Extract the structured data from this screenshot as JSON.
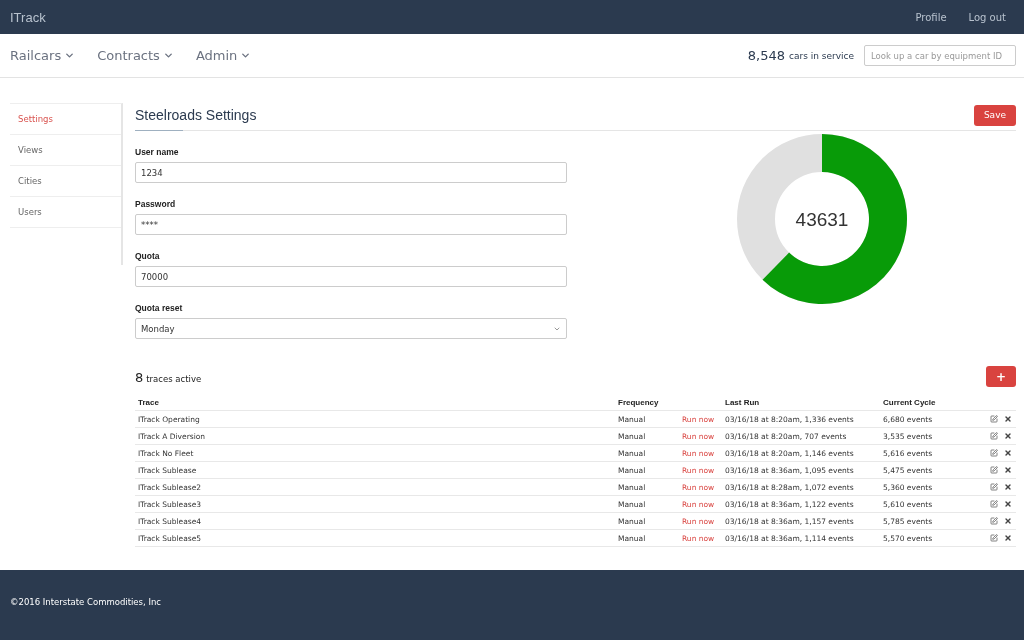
{
  "topbar": {
    "brand": "ITrack",
    "links": [
      "Profile",
      "Log out"
    ]
  },
  "nav": {
    "menus": [
      "Railcars",
      "Contracts",
      "Admin"
    ],
    "count": "8,548",
    "count_label": "cars in service",
    "search": {
      "placeholder": "Look up a car by equipment ID"
    }
  },
  "sidebar": {
    "items": [
      {
        "label": "Settings",
        "selected": true
      },
      {
        "label": "Views",
        "selected": false
      },
      {
        "label": "Cities",
        "selected": false
      },
      {
        "label": "Users",
        "selected": false
      }
    ]
  },
  "settings": {
    "title": "Steelroads Settings",
    "save": "Save",
    "fields": [
      {
        "kind": "text",
        "label": "User name",
        "value": "1234"
      },
      {
        "kind": "text",
        "label": "Password",
        "value": "****"
      },
      {
        "kind": "text",
        "label": "Quota",
        "value": "70000"
      },
      {
        "kind": "select",
        "label": "Quota reset",
        "value": "Monday"
      }
    ],
    "gauge": {
      "value": "43631"
    }
  },
  "traces": {
    "count": "8",
    "count_label": "traces active",
    "add": "+",
    "columns": [
      "Trace",
      "Frequency",
      "Last Run",
      "Current Cycle"
    ],
    "rows": [
      {
        "name": "ITrack Operating",
        "frequency": "Manual",
        "action": "Run now",
        "last_run": "03/16/18 at 8:20am, 1,336 events",
        "cycle": "6,680 events"
      },
      {
        "name": "ITrack A Diversion",
        "frequency": "Manual",
        "action": "Run now",
        "last_run": "03/16/18 at 8:20am, 707 events",
        "cycle": "3,535 events"
      },
      {
        "name": "ITrack No Fleet",
        "frequency": "Manual",
        "action": "Run now",
        "last_run": "03/16/18 at 8:20am, 1,146 events",
        "cycle": "5,616 events"
      },
      {
        "name": "ITrack Sublease",
        "frequency": "Manual",
        "action": "Run now",
        "last_run": "03/16/18 at 8:36am, 1,095 events",
        "cycle": "5,475 events"
      },
      {
        "name": "ITrack Sublease2",
        "frequency": "Manual",
        "action": "Run now",
        "last_run": "03/16/18 at 8:28am, 1,072 events",
        "cycle": "5,360 events"
      },
      {
        "name": "ITrack Sublease3",
        "frequency": "Manual",
        "action": "Run now",
        "last_run": "03/16/18 at 8:36am, 1,122 events",
        "cycle": "5,610 events"
      },
      {
        "name": "ITrack Sublease4",
        "frequency": "Manual",
        "action": "Run now",
        "last_run": "03/16/18 at 8:36am, 1,157 events",
        "cycle": "5,785 events"
      },
      {
        "name": "ITrack Sublease5",
        "frequency": "Manual",
        "action": "Run now",
        "last_run": "03/16/18 at 8:36am, 1,114 events",
        "cycle": "5,570 events"
      }
    ]
  },
  "footer": {
    "text": "©2016 Interstate Commodities, Inc"
  }
}
